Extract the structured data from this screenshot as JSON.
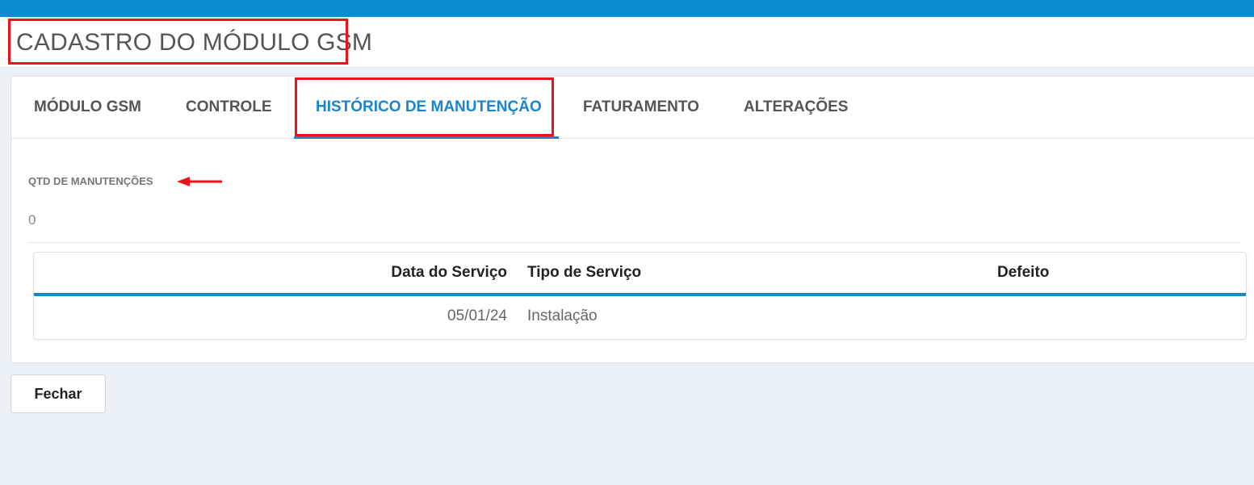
{
  "page": {
    "title": "CADASTRO DO MÓDULO GSM"
  },
  "tabs": [
    {
      "label": "MÓDULO GSM",
      "active": false
    },
    {
      "label": "CONTROLE",
      "active": false
    },
    {
      "label": "HISTÓRICO DE MANUTENÇÃO",
      "active": true
    },
    {
      "label": "FATURAMENTO",
      "active": false
    },
    {
      "label": "ALTERAÇÕES",
      "active": false
    }
  ],
  "maintenance": {
    "count_label": "QTD DE MANUTENÇÕES",
    "count_value": "0"
  },
  "table": {
    "columns": [
      "Data do Serviço",
      "Tipo de Serviço",
      "Defeito"
    ],
    "rows": [
      {
        "date": "05/01/24",
        "type": "Instalação",
        "defect": ""
      }
    ]
  },
  "footer": {
    "close_label": "Fechar"
  },
  "colors": {
    "topbar": "#0a8bcd",
    "accent": "#1a85c9",
    "annotation": "#e8141a",
    "background": "#eaf2f8"
  }
}
